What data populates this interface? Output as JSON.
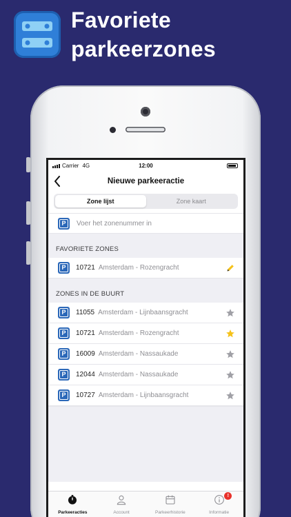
{
  "headline": {
    "line1": "Favoriete",
    "line2": "parkeerzones"
  },
  "statusbar": {
    "carrier": "Carrier",
    "network": "4G",
    "time": "12:00"
  },
  "navbar": {
    "title": "Nieuwe parkeeractie"
  },
  "segmented": {
    "zone_list": "Zone lijst",
    "zone_map": "Zone kaart",
    "selected": "Zone lijst"
  },
  "search": {
    "placeholder": "Voer het zonenummer in"
  },
  "p_symbol": "P",
  "favorites": {
    "header": "FAVORIETE ZONES",
    "items": [
      {
        "number": "10721",
        "name": "Amsterdam - Rozengracht",
        "action_icon": "pencil-icon"
      }
    ]
  },
  "nearby": {
    "header": "ZONES IN DE BUURT",
    "items": [
      {
        "number": "11055",
        "name": "Amsterdam - Lijnbaansgracht",
        "favorite": false
      },
      {
        "number": "10721",
        "name": "Amsterdam - Rozengracht",
        "favorite": true
      },
      {
        "number": "16009",
        "name": "Amsterdam - Nassaukade",
        "favorite": false
      },
      {
        "number": "12044",
        "name": "Amsterdam - Nassaukade",
        "favorite": false
      },
      {
        "number": "10727",
        "name": "Amsterdam - Lijnbaansgracht",
        "favorite": false
      }
    ]
  },
  "tabbar": {
    "items": [
      {
        "label": "Parkeeracties",
        "icon": "stopwatch-icon",
        "active": true
      },
      {
        "label": "Account",
        "icon": "person-icon",
        "active": false
      },
      {
        "label": "Parkeerhistorie",
        "icon": "calendar-icon",
        "active": false
      },
      {
        "label": "Informatie",
        "icon": "info-icon",
        "active": false,
        "badge": "!"
      }
    ]
  },
  "colors": {
    "background": "#2a2a6e",
    "brand_blue": "#2a67b8",
    "star_active": "#f5c21b",
    "star_inactive": "#a0a0a6",
    "badge_red": "#e8322b"
  }
}
